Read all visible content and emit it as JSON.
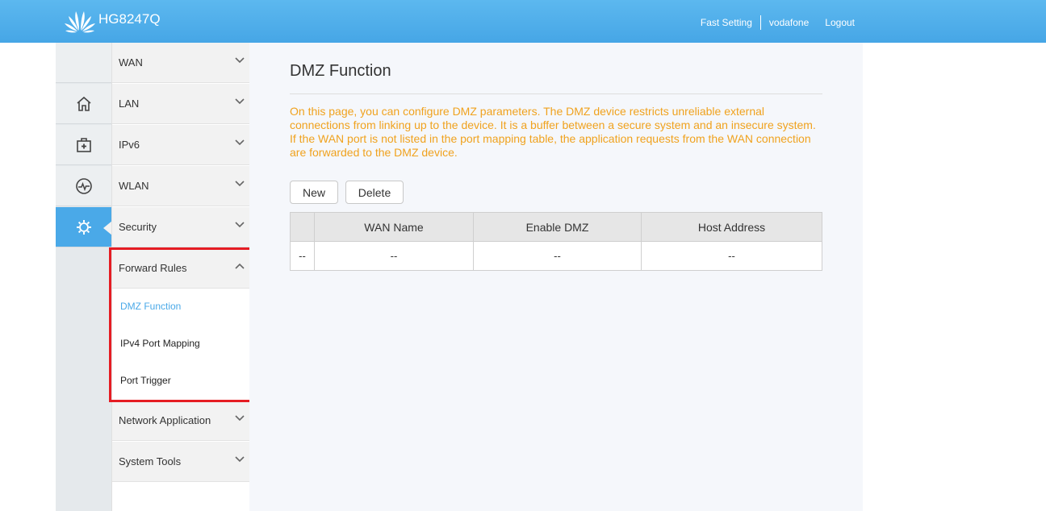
{
  "header": {
    "model": "HG8247Q",
    "links": {
      "fast_setting": "Fast Setting",
      "user": "vodafone",
      "logout": "Logout"
    }
  },
  "icon_nav": [
    {
      "icon": "home-icon",
      "active": false
    },
    {
      "icon": "medical-kit-icon",
      "active": false
    },
    {
      "icon": "pulse-monitor-icon",
      "active": false
    },
    {
      "icon": "gear-icon",
      "active": true
    }
  ],
  "menu": {
    "items": [
      {
        "label": "WAN"
      },
      {
        "label": "LAN"
      },
      {
        "label": "IPv6"
      },
      {
        "label": "WLAN"
      },
      {
        "label": "Security"
      },
      {
        "label": "Forward Rules",
        "expanded": true
      },
      {
        "label": "Network Application"
      },
      {
        "label": "System Tools"
      }
    ],
    "sub_items": [
      {
        "label": "DMZ Function",
        "active": true
      },
      {
        "label": "IPv4 Port Mapping"
      },
      {
        "label": "Port Trigger"
      }
    ]
  },
  "main": {
    "title": "DMZ Function",
    "description": "On this page, you can configure DMZ parameters. The DMZ device restricts unreliable external connections from linking up to the device. It is a buffer between a secure system and an insecure system. If the WAN port is not listed in the port mapping table, the application requests from the WAN connection are forwarded to the DMZ device.",
    "buttons": {
      "new": "New",
      "delete": "Delete"
    },
    "table": {
      "headers": [
        "",
        "WAN Name",
        "Enable DMZ",
        "Host Address"
      ],
      "rows": [
        [
          "--",
          "--",
          "--",
          "--"
        ]
      ]
    }
  },
  "colors": {
    "accent": "#4aa9e8",
    "header": "#4fadea",
    "description": "#f0a21e",
    "highlight": "#e51c23"
  }
}
